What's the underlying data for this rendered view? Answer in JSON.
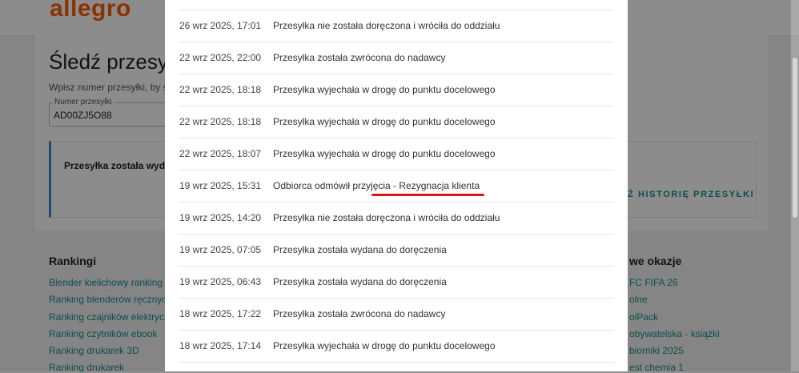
{
  "brand": {
    "logo": "allegro"
  },
  "page": {
    "title": "Śledź przesyłkę",
    "hint": "Wpisz numer przesyłki, by sprawdzić",
    "parcel_label": "Numer przesyłki",
    "parcel_value": "AD00ZJ5O88",
    "status": "Przesyłka została wydana",
    "history_link": "Ź HISTORIĘ PRZESYŁKI"
  },
  "footer": {
    "rankings_title": "Rankingi",
    "rankings": [
      "Blender kielichowy ranking",
      "Ranking blenderów ręcznych",
      "Ranking czajników elektrycznych",
      "Ranking czytników ebook",
      "Ranking drukarek 3D",
      "Ranking drukarek"
    ],
    "deals_title": "we okazje",
    "deals": [
      "FC FIFA 26",
      "olne",
      "olPack",
      "obywatelska - książki",
      "biorniki 2025",
      "est chemia 1"
    ]
  },
  "history": [
    {
      "date": "26 wrz 2025, 17:01",
      "desc": "Przesyłka nie została doręczona i wróciła do oddziału"
    },
    {
      "date": "22 wrz 2025, 22:00",
      "desc": "Przesyłka została zwrócona do nadawcy"
    },
    {
      "date": "22 wrz 2025, 18:18",
      "desc": "Przesyłka wyjechała w drogę do punktu docelowego"
    },
    {
      "date": "22 wrz 2025, 18:18",
      "desc": "Przesyłka wyjechała w drogę do punktu docelowego"
    },
    {
      "date": "22 wrz 2025, 18:07",
      "desc": "Przesyłka wyjechała w drogę do punktu docelowego"
    },
    {
      "date": "19 wrz 2025, 15:31",
      "desc": "Odbiorca odmówił przyjęcia - Rezygnacja klienta"
    },
    {
      "date": "19 wrz 2025, 14:20",
      "desc": "Przesyłka nie została doręczona i wróciła do oddziału"
    },
    {
      "date": "19 wrz 2025, 07:05",
      "desc": "Przesyłka została wydana do doręczenia"
    },
    {
      "date": "19 wrz 2025, 06:43",
      "desc": "Przesyłka została wydana do doręczenia"
    },
    {
      "date": "18 wrz 2025, 17:22",
      "desc": "Przesyłka została zwrócona do nadawcy"
    },
    {
      "date": "18 wrz 2025, 17:14",
      "desc": "Przesyłka wyjechała w drogę do punktu docelowego"
    }
  ],
  "colors": {
    "brand": "#ff5a00",
    "link": "#1a8a8a",
    "annotation_underline": "#d8141a",
    "status_accent": "#3b86c6"
  }
}
